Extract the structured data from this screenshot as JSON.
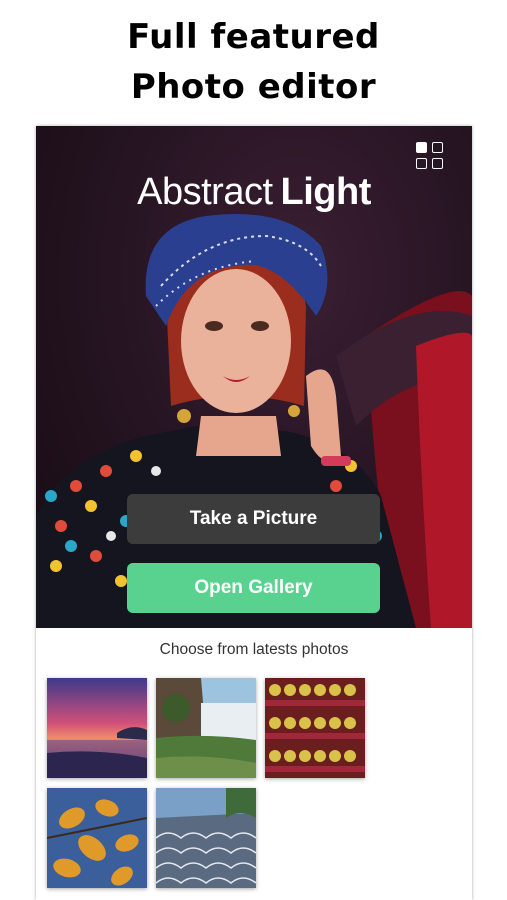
{
  "promo": {
    "line1": "Full featured",
    "line2": "Photo editor"
  },
  "app": {
    "brand_regular": "Abstract",
    "brand_bold": "Light",
    "menu_icon": "grid-icon"
  },
  "actions": {
    "take_picture": "Take a Picture",
    "open_gallery": "Open Gallery"
  },
  "latest": {
    "heading": "Choose from latests photos",
    "photos": [
      {
        "icon": "sunset-beach-photo"
      },
      {
        "icon": "waterfall-photo"
      },
      {
        "icon": "produce-shelves-photo"
      },
      {
        "icon": "autumn-leaves-photo"
      },
      {
        "icon": "pavement-pattern-photo"
      }
    ]
  },
  "colors": {
    "take_button": "#3c3c3c",
    "gallery_button": "#5ad28f",
    "hero_background": "#241320"
  }
}
